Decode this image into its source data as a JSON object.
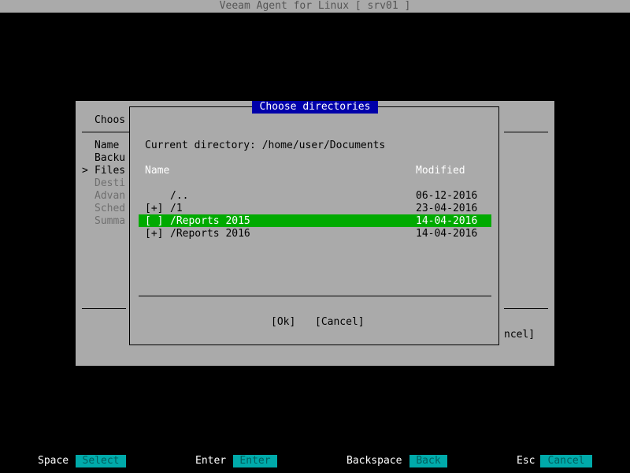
{
  "window": {
    "title": "Veeam Agent for Linux   [ srv01 ]"
  },
  "wizard": {
    "heading": "Choos",
    "steps": [
      {
        "label": "Name",
        "marker": "",
        "state": "normal"
      },
      {
        "label": "Backu",
        "marker": "",
        "state": "normal"
      },
      {
        "label": "Files",
        "marker": ">",
        "state": "current"
      },
      {
        "label": "Desti",
        "marker": "",
        "state": "disabled"
      },
      {
        "label": "Advan",
        "marker": "",
        "state": "disabled"
      },
      {
        "label": "Sched",
        "marker": "",
        "state": "disabled"
      },
      {
        "label": "Summa",
        "marker": "",
        "state": "disabled"
      }
    ],
    "cancel_fragment": "ncel]"
  },
  "dialog": {
    "title": "Choose directories",
    "current_directory": "Current directory: /home/user/Documents",
    "columns": {
      "name": "Name",
      "modified": "Modified"
    },
    "rows": [
      {
        "check": "",
        "name": "/..",
        "modified": "06-12-2016",
        "selected": false
      },
      {
        "check": "[+]",
        "name": "/1",
        "modified": "23-04-2016",
        "selected": false
      },
      {
        "check": "[ ]",
        "name": "/Reports 2015",
        "modified": "14-04-2016",
        "selected": true
      },
      {
        "check": "[+]",
        "name": "/Reports 2016",
        "modified": "14-04-2016",
        "selected": false
      }
    ],
    "ok_label": "[Ok]",
    "cancel_label": "[Cancel]"
  },
  "hotkeys": [
    {
      "key": "Space",
      "action": "Select"
    },
    {
      "key": "Enter",
      "action": "Enter"
    },
    {
      "key": "Backspace",
      "action": "Back"
    },
    {
      "key": "Esc",
      "action": "Cancel"
    }
  ],
  "colors": {
    "screen_bg": "#000000",
    "panel_bg": "#aaaaaa",
    "dialog_title_bg": "#0000aa",
    "selection_bg": "#00aa00",
    "hotkey_bg": "#00aaaa"
  }
}
